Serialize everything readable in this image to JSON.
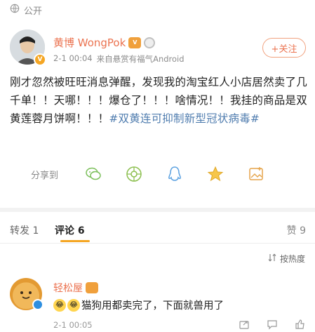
{
  "visibility": {
    "label": "公开",
    "icon": "globe-icon"
  },
  "author": {
    "name": "黄博 WongPok",
    "badge_vip": "V",
    "verified": "V",
    "time": "2-1 00:04",
    "source": "来自悬赏有福气Android",
    "follow_label": "+关注"
  },
  "post": {
    "text": "刚才忽然被旺旺消息弹醒，发现我的淘宝红人小店居然卖了几千单！！天哪！！！爆仓了！！！啥情况！！我挂的商品是双黄莲蓉月饼啊！！！",
    "topic": "#双黄连可抑制新型冠状病毒#"
  },
  "share": {
    "label": "分享到",
    "icons": [
      "wechat-icon",
      "moments-icon",
      "qq-icon",
      "qzone-star-icon",
      "image-share-icon"
    ]
  },
  "tabs": {
    "repost": "转发 1",
    "comment": "评论 6",
    "like": "赞 9"
  },
  "sort": {
    "label": "按热度",
    "icon": "sort-icon"
  },
  "comment": {
    "name": "轻松屋",
    "text": "猫狗用都卖完了，下面就兽用了",
    "time": "2-1 00:05",
    "actions": [
      "share-icon",
      "comment-icon",
      "like-icon"
    ]
  },
  "colors": {
    "name": "#eb7350",
    "topic": "#507daf",
    "accent": "#f5a623"
  }
}
